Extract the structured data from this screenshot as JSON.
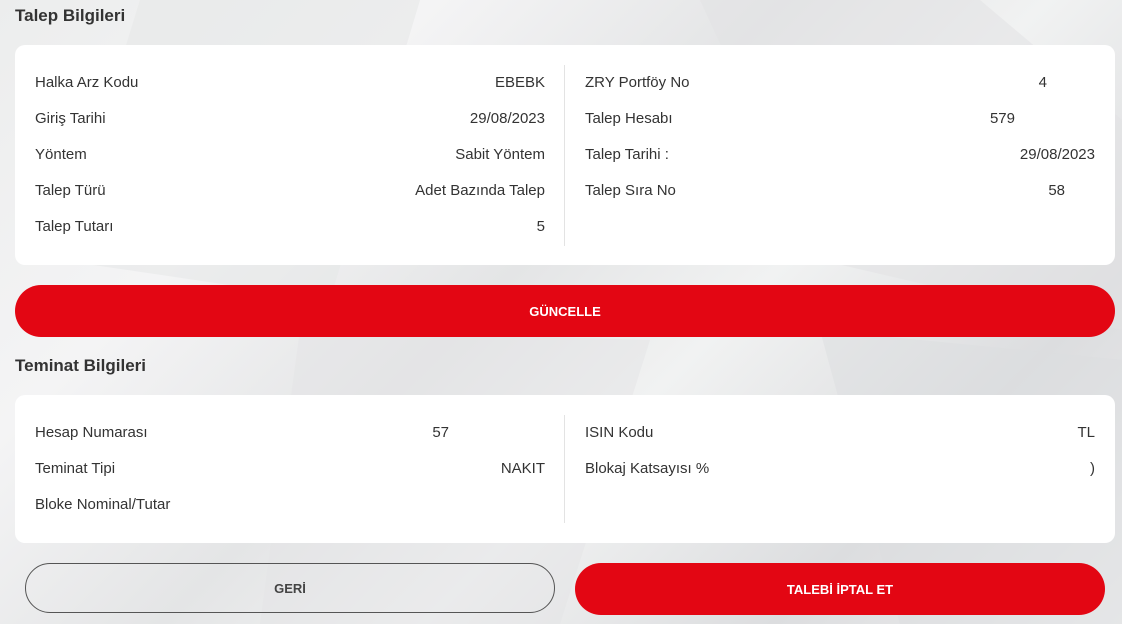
{
  "talep": {
    "title": "Talep Bilgileri",
    "left": [
      {
        "label": "Halka Arz Kodu",
        "value": "EBEBK"
      },
      {
        "label": "Giriş Tarihi",
        "value": "29/08/2023"
      },
      {
        "label": "Yöntem",
        "value": "Sabit Yöntem"
      },
      {
        "label": "Talep Türü",
        "value": "Adet Bazında Talep"
      },
      {
        "label": "Talep Tutarı",
        "value": "5"
      }
    ],
    "right": [
      {
        "label": "ZRY Portföy No",
        "value": "4"
      },
      {
        "label": "Talep Hesabı",
        "value": "579"
      },
      {
        "label": "Talep Tarihi :",
        "value": "29/08/2023"
      },
      {
        "label": "Talep Sıra No",
        "value": "58"
      }
    ],
    "update_button": "GÜNCELLE"
  },
  "teminat": {
    "title": "Teminat Bilgileri",
    "left": [
      {
        "label": "Hesap Numarası",
        "value": "57"
      },
      {
        "label": "Teminat Tipi",
        "value": "NAKIT"
      },
      {
        "label": "Bloke Nominal/Tutar",
        "value": ""
      }
    ],
    "right": [
      {
        "label": "ISIN Kodu",
        "value": "TL"
      },
      {
        "label": "Blokaj Katsayısı %",
        "value": ")"
      }
    ]
  },
  "actions": {
    "back_label": "GERİ",
    "cancel_label": "TALEBİ İPTAL ET"
  },
  "colors": {
    "accent": "#e30613",
    "card": "#ffffff",
    "text": "#333333"
  }
}
